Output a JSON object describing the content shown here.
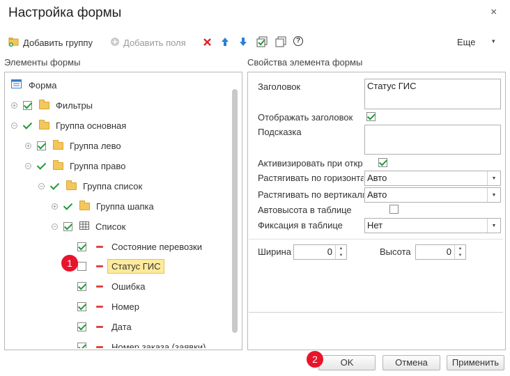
{
  "window": {
    "title": "Настройка формы",
    "close_glyph": "×"
  },
  "toolbar": {
    "add_group": "Добавить группу",
    "add_fields": "Добавить поля",
    "more": "Еще",
    "more_arrow": "▾",
    "help_glyph": "?"
  },
  "left_panel": {
    "title": "Элементы формы",
    "tree": [
      {
        "label": "Форма"
      },
      {
        "label": "Фильтры"
      },
      {
        "label": "Группа основная"
      },
      {
        "label": "Группа лево"
      },
      {
        "label": "Группа право"
      },
      {
        "label": "Группа список"
      },
      {
        "label": "Группа шапка"
      },
      {
        "label": "Список"
      },
      {
        "label": "Состояние перевозки"
      },
      {
        "label": "Статус ГИС"
      },
      {
        "label": "Ошибка"
      },
      {
        "label": "Номер"
      },
      {
        "label": "Дата"
      },
      {
        "label": "Номер заказа (заявки)"
      }
    ]
  },
  "right_panel": {
    "title": "Свойства элемента формы",
    "props": {
      "caption_label": "Заголовок",
      "caption_value": "Статус ГИС",
      "show_caption_label": "Отображать заголовок",
      "hint_label": "Подсказка",
      "hint_value": "",
      "activate_label": "Активизировать при откр",
      "stretch_h_label": "Растягивать по горизонта",
      "stretch_h_value": "Авто",
      "stretch_v_label": "Растягивать по вертикали",
      "stretch_v_value": "Авто",
      "autoheight_label": "Автовысота в таблице",
      "fix_label": "Фиксация в таблице",
      "fix_value": "Нет",
      "width_label": "Ширина",
      "width_value": "0",
      "height_label": "Высота",
      "height_value": "0"
    }
  },
  "footer": {
    "ok": "OK",
    "cancel": "Отмена",
    "apply": "Применить"
  },
  "badges": {
    "b1": "1",
    "b2": "2"
  },
  "colors": {
    "accent_red": "#e8142b",
    "check_green": "#1e9a35",
    "selection": "#fdea9c"
  }
}
